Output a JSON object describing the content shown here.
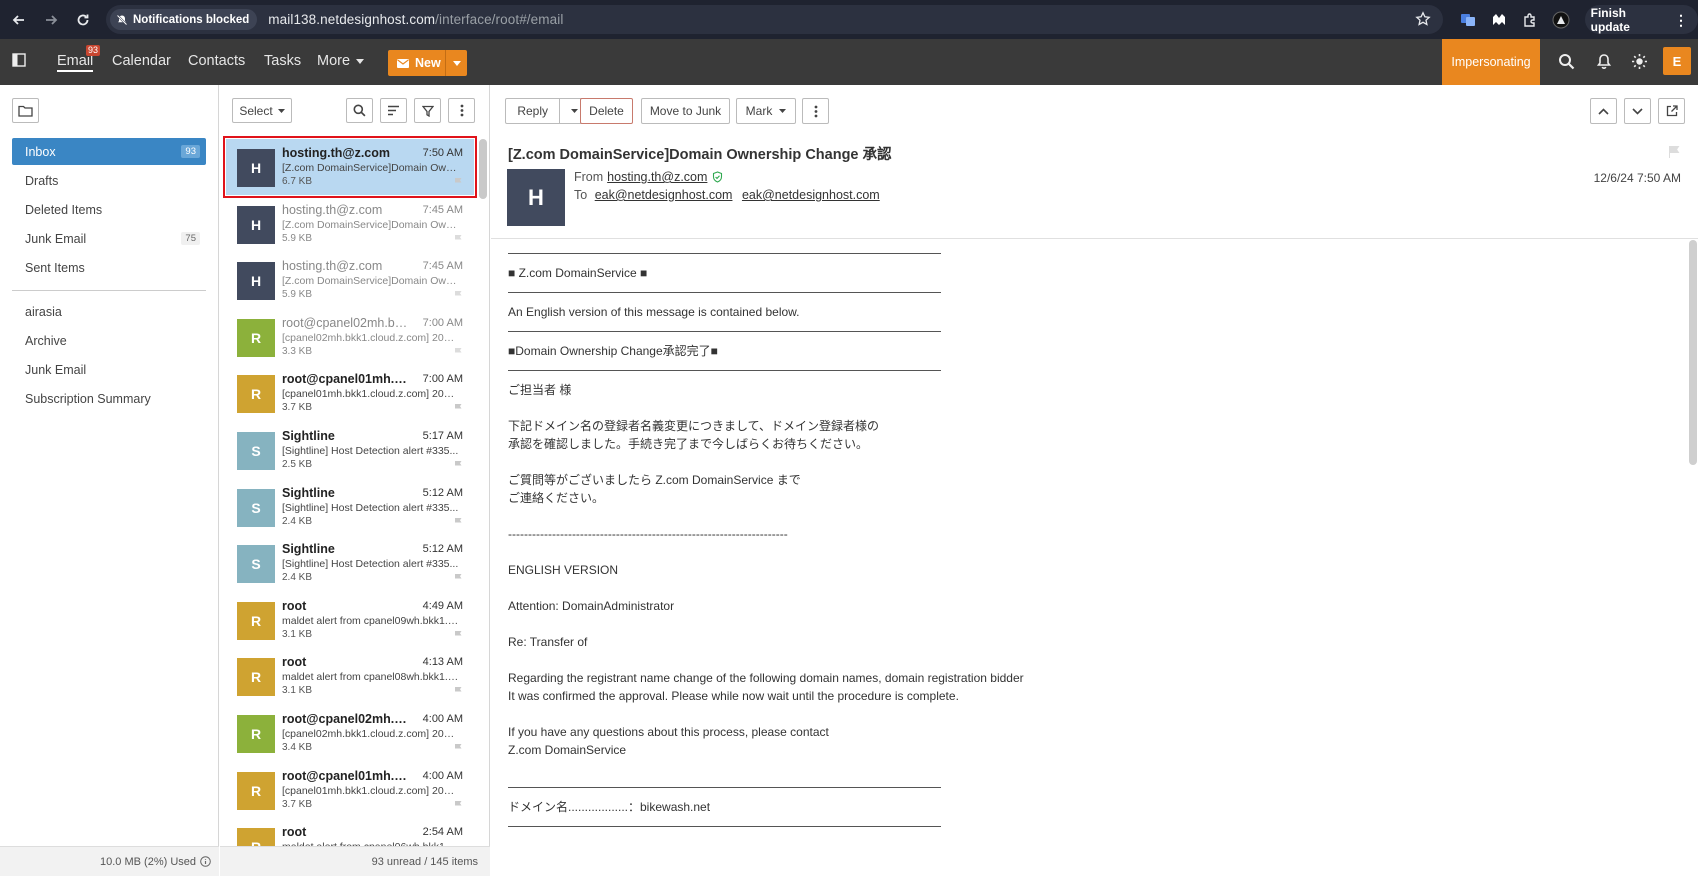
{
  "browser": {
    "notif_chip": "Notifications blocked",
    "url_host": "mail138.netdesignhost.com",
    "url_path": "/interface/root#/email",
    "finish_update": "Finish update"
  },
  "header": {
    "nav": [
      "Email",
      "Calendar",
      "Contacts",
      "Tasks",
      "More"
    ],
    "email_badge": "93",
    "new_label": "New",
    "impersonating": "Impersonating",
    "user_initial": "E",
    "colors": {
      "bar": "#3a3a3a",
      "accent": "#e9871f"
    }
  },
  "folders": {
    "items": [
      {
        "label": "Inbox",
        "count": "93"
      },
      {
        "label": "Drafts"
      },
      {
        "label": "Deleted Items"
      },
      {
        "label": "Junk Email",
        "count": "75"
      },
      {
        "label": "Sent Items"
      }
    ],
    "extra": [
      "airasia",
      "Archive",
      "Junk Email",
      "Subscription Summary"
    ],
    "quota": "10.0 MB (2%) Used"
  },
  "list": {
    "select_label": "Select",
    "footer": "93 unread / 145 items",
    "messages": [
      {
        "initial": "H",
        "color": "#414a5e",
        "from": "hosting.th@z.com",
        "time": "7:50 AM",
        "subject": "[Z.com DomainService]Domain Own...",
        "size": "6.7 KB",
        "read": false,
        "selected": true
      },
      {
        "initial": "H",
        "color": "#414a5e",
        "from": "hosting.th@z.com",
        "time": "7:45 AM",
        "subject": "[Z.com DomainService]Domain Own...",
        "size": "5.9 KB",
        "read": true
      },
      {
        "initial": "H",
        "color": "#414a5e",
        "from": "hosting.th@z.com",
        "time": "7:45 AM",
        "subject": "[Z.com DomainService]Domain Own...",
        "size": "5.9 KB",
        "read": true
      },
      {
        "initial": "R",
        "color": "#8cb13b",
        "from": "root@cpanel02mh.bkk...",
        "time": "7:00 AM",
        "subject": "[cpanel02mh.bkk1.cloud.z.com] 2024...",
        "size": "3.3 KB",
        "read": true
      },
      {
        "initial": "R",
        "color": "#cfa331",
        "from": "root@cpanel01mh.bkk...",
        "time": "7:00 AM",
        "subject": "[cpanel01mh.bkk1.cloud.z.com] 2024...",
        "size": "3.7 KB",
        "read": false
      },
      {
        "initial": "S",
        "color": "#86b3c0",
        "from": "Sightline",
        "time": "5:17 AM",
        "subject": "[Sightline] Host Detection alert #335...",
        "size": "2.5 KB",
        "read": false
      },
      {
        "initial": "S",
        "color": "#86b3c0",
        "from": "Sightline",
        "time": "5:12 AM",
        "subject": "[Sightline] Host Detection alert #335...",
        "size": "2.4 KB",
        "read": false
      },
      {
        "initial": "S",
        "color": "#86b3c0",
        "from": "Sightline",
        "time": "5:12 AM",
        "subject": "[Sightline] Host Detection alert #335...",
        "size": "2.4 KB",
        "read": false
      },
      {
        "initial": "R",
        "color": "#cfa331",
        "from": "root",
        "time": "4:49 AM",
        "subject": "maldet alert from cpanel09wh.bkk1.c...",
        "size": "3.1 KB",
        "read": false
      },
      {
        "initial": "R",
        "color": "#cfa331",
        "from": "root",
        "time": "4:13 AM",
        "subject": "maldet alert from cpanel08wh.bkk1.c...",
        "size": "3.1 KB",
        "read": false
      },
      {
        "initial": "R",
        "color": "#8cb13b",
        "from": "root@cpanel02mh.bk...",
        "time": "4:00 AM",
        "subject": "[cpanel02mh.bkk1.cloud.z.com] 2024...",
        "size": "3.4 KB",
        "read": false
      },
      {
        "initial": "R",
        "color": "#cfa331",
        "from": "root@cpanel01mh.bkk...",
        "time": "4:00 AM",
        "subject": "[cpanel01mh.bkk1.cloud.z.com] 2024...",
        "size": "3.7 KB",
        "read": false
      },
      {
        "initial": "R",
        "color": "#cfa331",
        "from": "root",
        "time": "2:54 AM",
        "subject": "maldet alert from cpanel06wh.bkk1.c...",
        "size": "",
        "read": false
      }
    ]
  },
  "reader": {
    "buttons": {
      "reply": "Reply",
      "delete": "Delete",
      "junk": "Move to Junk",
      "mark": "Mark"
    },
    "subject": "[Z.com DomainService]Domain Ownership Change 承認",
    "sender_initial": "H",
    "from_label": "From",
    "from_addr": "hosting.th@z.com",
    "to_label": "To",
    "to_addrs": [
      "eak@netdesignhost.com",
      "eak@netdesignhost.com"
    ],
    "date": "12/6/24 7:50 AM",
    "body": [
      {
        "t": "rule"
      },
      {
        "t": "text",
        "v": "■ Z.com DomainService ■"
      },
      {
        "t": "rule"
      },
      {
        "t": "text",
        "v": "An English version of this message is contained below."
      },
      {
        "t": "rule"
      },
      {
        "t": "text",
        "v": "■Domain Ownership Change承認完了■"
      },
      {
        "t": "rule"
      },
      {
        "t": "text",
        "v": "ご担当者 様"
      },
      {
        "t": "blank"
      },
      {
        "t": "text",
        "v": "下記ドメイン名の登録者名義変更につきまして、ドメイン登録者様の"
      },
      {
        "t": "text",
        "v": "承認を確認しました。手続き完了まで今しばらくお待ちください。"
      },
      {
        "t": "blank"
      },
      {
        "t": "text",
        "v": "ご質問等がございましたら Z.com DomainService まで"
      },
      {
        "t": "text",
        "v": "ご連絡ください。"
      },
      {
        "t": "blank"
      },
      {
        "t": "text",
        "v": "----------------------------------------------------------------------"
      },
      {
        "t": "blank"
      },
      {
        "t": "text",
        "v": "ENGLISH VERSION"
      },
      {
        "t": "blank"
      },
      {
        "t": "text",
        "v": "Attention: DomainAdministrator"
      },
      {
        "t": "blank"
      },
      {
        "t": "text",
        "v": "Re: Transfer of"
      },
      {
        "t": "blank"
      },
      {
        "t": "text",
        "v": "Regarding the registrant name change of the following domain names, domain registration bidder"
      },
      {
        "t": "text",
        "v": "It was confirmed the approval. Please while now wait until the procedure is complete."
      },
      {
        "t": "blank"
      },
      {
        "t": "text",
        "v": "If you have any questions about this process, please contact"
      },
      {
        "t": "text",
        "v": "Z.com DomainService"
      },
      {
        "t": "blank"
      },
      {
        "t": "rule"
      },
      {
        "t": "text",
        "v": "ドメイン名..................：bikewash.net"
      },
      {
        "t": "rule"
      }
    ]
  }
}
